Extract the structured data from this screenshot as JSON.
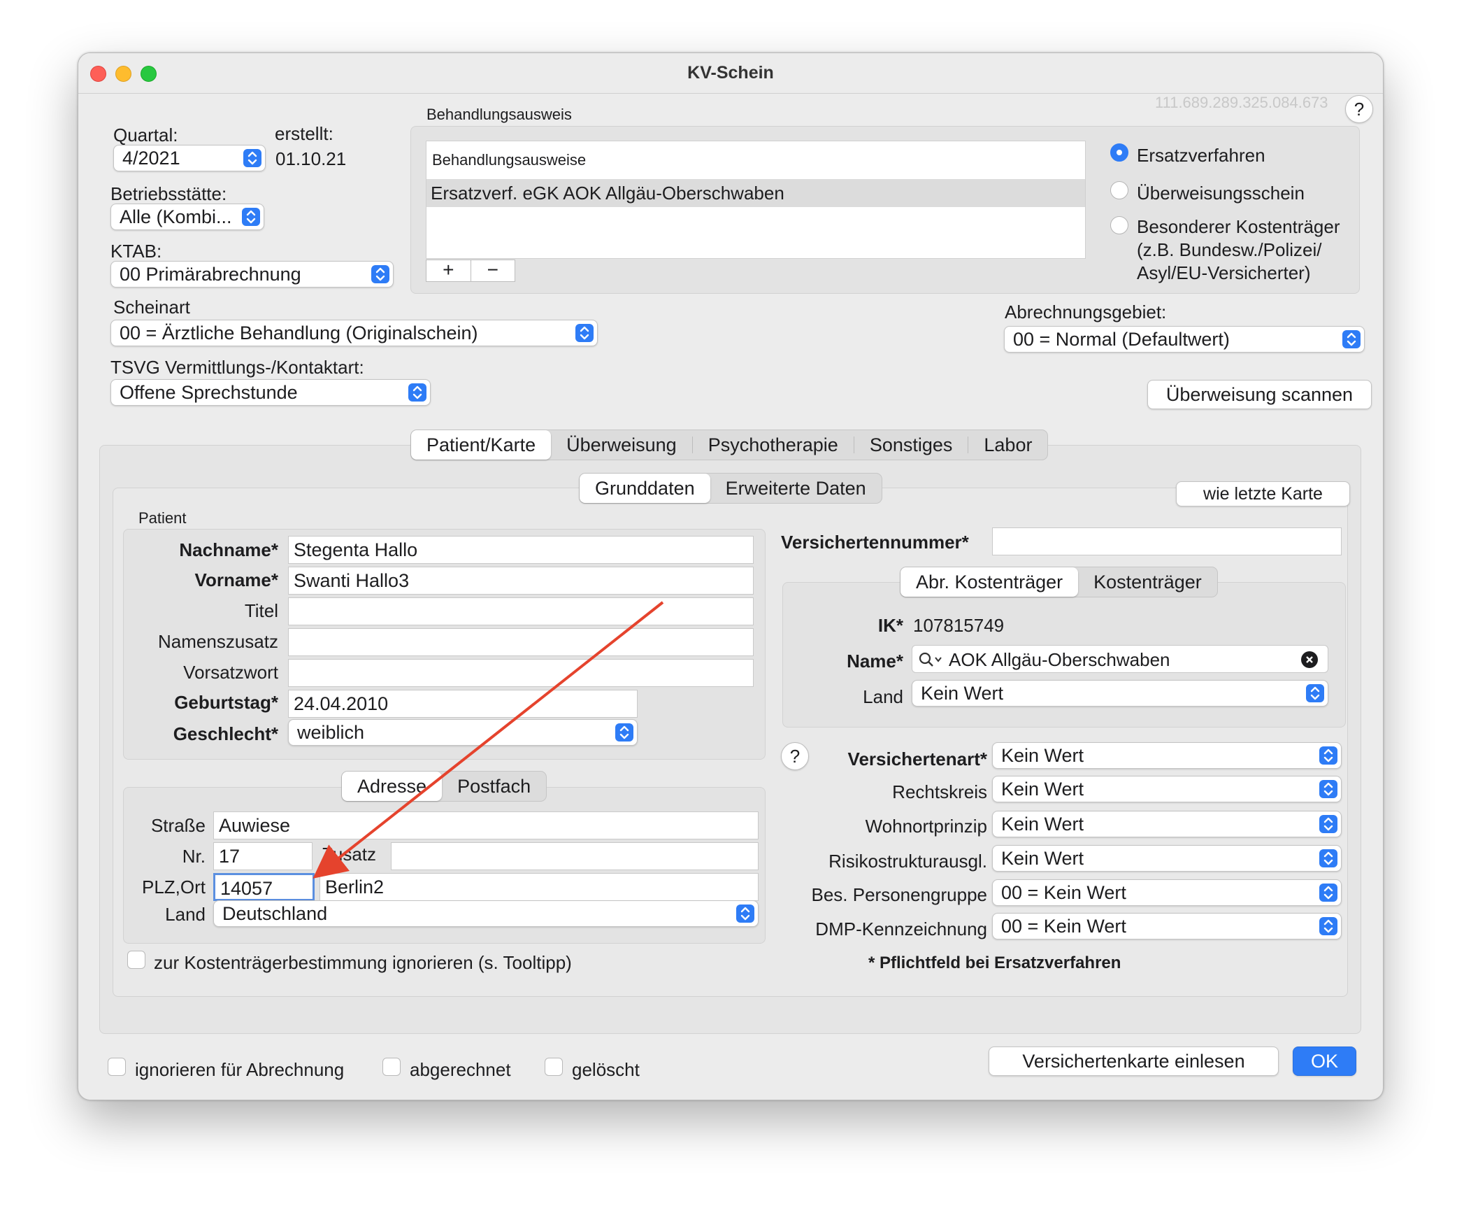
{
  "window": {
    "title": "KV-Schein",
    "id_number": "111.689.289.325.084.673"
  },
  "header": {
    "quartal_label": "Quartal:",
    "quartal_value": "4/2021",
    "erstellt_label": "erstellt:",
    "erstellt_value": "01.10.21",
    "betriebsstaette_label": "Betriebsstätte:",
    "betriebsstaette_value": "Alle (Kombi...",
    "ktab_label": "KTAB:",
    "ktab_value": "00 Primärabrechnung",
    "scheinart_label": "Scheinart",
    "scheinart_value": "00 = Ärztliche Behandlung (Originalschein)",
    "tsvg_label": "TSVG Vermittlungs-/Kontaktart:",
    "tsvg_value": "Offene Sprechstunde"
  },
  "behandlungsausweis": {
    "group_label": "Behandlungsausweis",
    "list_header": "Behandlungsausweise",
    "rows": [
      "Ersatzverf. eGK AOK Allgäu-Oberschwaben"
    ],
    "add": "+",
    "remove": "−"
  },
  "radios": [
    {
      "label": "Ersatzverfahren",
      "selected": true
    },
    {
      "label": "Überweisungsschein",
      "selected": false
    },
    {
      "label": "Besonderer Kostenträger\n(z.B. Bundesw./Polizei/\nAsyl/EU-Versicherter)",
      "selected": false
    }
  ],
  "abrechnungsgebiet": {
    "label": "Abrechnungsgebiet:",
    "value": "00 = Normal (Defaultwert)"
  },
  "scan_button": "Überweisung scannen",
  "tabs": [
    "Patient/Karte",
    "Überweisung",
    "Psychotherapie",
    "Sonstiges",
    "Labor"
  ],
  "subtabs": [
    "Grunddaten",
    "Erweiterte Daten"
  ],
  "wie_letzte_karte": "wie letzte Karte",
  "patient": {
    "group_label": "Patient",
    "fields": [
      {
        "label": "Nachname*",
        "value": "Stegenta Hallo",
        "bold": true
      },
      {
        "label": "Vorname*",
        "value": "Swanti  Hallo3",
        "bold": true
      },
      {
        "label": "Titel",
        "value": "",
        "bold": false
      },
      {
        "label": "Namenszusatz",
        "value": "",
        "bold": false
      },
      {
        "label": "Vorsatzwort",
        "value": "",
        "bold": false
      }
    ],
    "geburtstag_label": "Geburtstag*",
    "geburtstag_value": "24.04.2010",
    "geschlecht_label": "Geschlecht*",
    "geschlecht_value": "weiblich"
  },
  "address_tabs": [
    "Adresse",
    "Postfach"
  ],
  "address": {
    "strasse_label": "Straße",
    "strasse_value": "Auwiese",
    "nr_label": "Nr.",
    "nr_value": "17",
    "zusatz_label": "Zusatz",
    "zusatz_value": "",
    "plz_label": "PLZ,Ort",
    "plz_value": "14057",
    "ort_value": "Berlin2",
    "land_label": "Land",
    "land_value": "Deutschland"
  },
  "ignore_checkbox": "zur Kostenträgerbestimmung ignorieren (s. Tooltipp)",
  "insurance": {
    "versichertennummer_label": "Versichertennummer*",
    "versichertennummer_value": "",
    "kt_tabs": [
      "Abr. Kostenträger",
      "Kostenträger"
    ],
    "ik_label": "IK*",
    "ik_value": "107815749",
    "name_label": "Name*",
    "name_value": "AOK Allgäu-Oberschwaben",
    "land_label": "Land",
    "land_value": "Kein Wert"
  },
  "insurance_selects": [
    {
      "label": "Versichertenart*",
      "value": "Kein Wert",
      "bold": true
    },
    {
      "label": "Rechtskreis",
      "value": "Kein Wert",
      "bold": false
    },
    {
      "label": "Wohnortprinzip",
      "value": "Kein Wert",
      "bold": false
    },
    {
      "label": "Risikostrukturausgl.",
      "value": "Kein Wert",
      "bold": false
    },
    {
      "label": "Bes. Personengruppe",
      "value": "00 = Kein Wert",
      "bold": false
    },
    {
      "label": "DMP-Kennzeichnung",
      "value": "00 = Kein Wert",
      "bold": false
    }
  ],
  "pflichtfeld_note": "* Pflichtfeld bei Ersatzverfahren",
  "footer": {
    "checkboxes": [
      "ignorieren für Abrechnung",
      "abgerechnet",
      "gelöscht"
    ],
    "read_card": "Versichertenkarte einlesen",
    "ok": "OK"
  },
  "colors": {
    "accent": "#2e7cf6",
    "annotation_arrow": "#e5432d"
  }
}
